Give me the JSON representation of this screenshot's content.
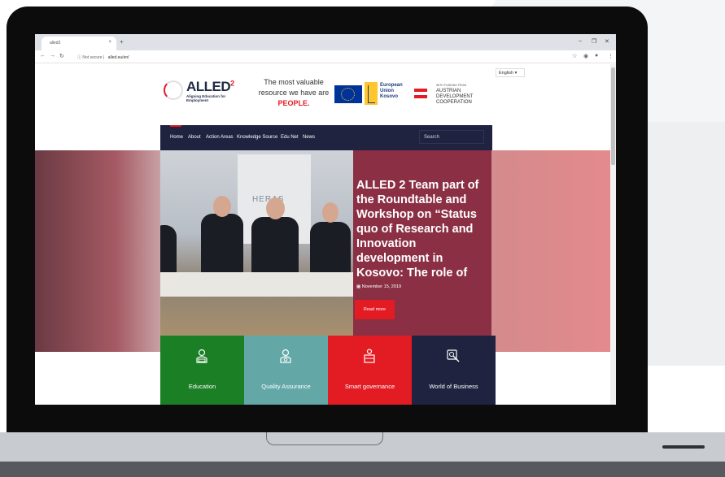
{
  "browser": {
    "tab_title": "alled2",
    "tab_close": "×",
    "new_tab": "+",
    "security": "Not secure",
    "url": "alled.eu/en/",
    "window_controls": [
      "–",
      "❐",
      "✕"
    ],
    "nav_icons": [
      "back-icon",
      "forward-icon",
      "reload-icon",
      "star-icon",
      "extension-icon",
      "profile-icon",
      "menu-icon"
    ]
  },
  "header": {
    "language": "English",
    "logo": {
      "name": "ALLED",
      "superscript": "2",
      "subtitle": "Aligning Education for Employment"
    },
    "tagline": {
      "line1": "The most valuable",
      "line2": "resource we have are",
      "highlight": "PEOPLE."
    },
    "eu": {
      "line1": "European",
      "line2": "Union",
      "line3": "Kosovo"
    },
    "austria": {
      "funding": "WITH FUNDING FROM",
      "line1": "AUSTRIAN",
      "line2": "DEVELOPMENT",
      "line3": "COOPERATION"
    }
  },
  "nav": {
    "items": [
      "Home",
      "About",
      "Action Areas",
      "Knowledge Source",
      "Edu Net",
      "News"
    ],
    "search_label": "Search"
  },
  "hero": {
    "banner_text": "HERAS",
    "title": "ALLED 2 Team part of the Roundtable and Workshop on “Status quo of Research and Innovation development in Kosovo: The role of",
    "date": "November 15, 2019",
    "read_more": "Read more"
  },
  "tiles": [
    {
      "label": "Education",
      "icon": "education-icon"
    },
    {
      "label": "Quality Assurance",
      "icon": "quality-icon"
    },
    {
      "label": "Smart governance",
      "icon": "governance-icon"
    },
    {
      "label": "World of Business",
      "icon": "business-icon"
    }
  ],
  "colors": {
    "brand_red": "#e31b23",
    "navy": "#1f2340",
    "education_green": "#1a7f25",
    "quality_teal": "#63a8a7",
    "hero_overlay": "#8b3044"
  }
}
